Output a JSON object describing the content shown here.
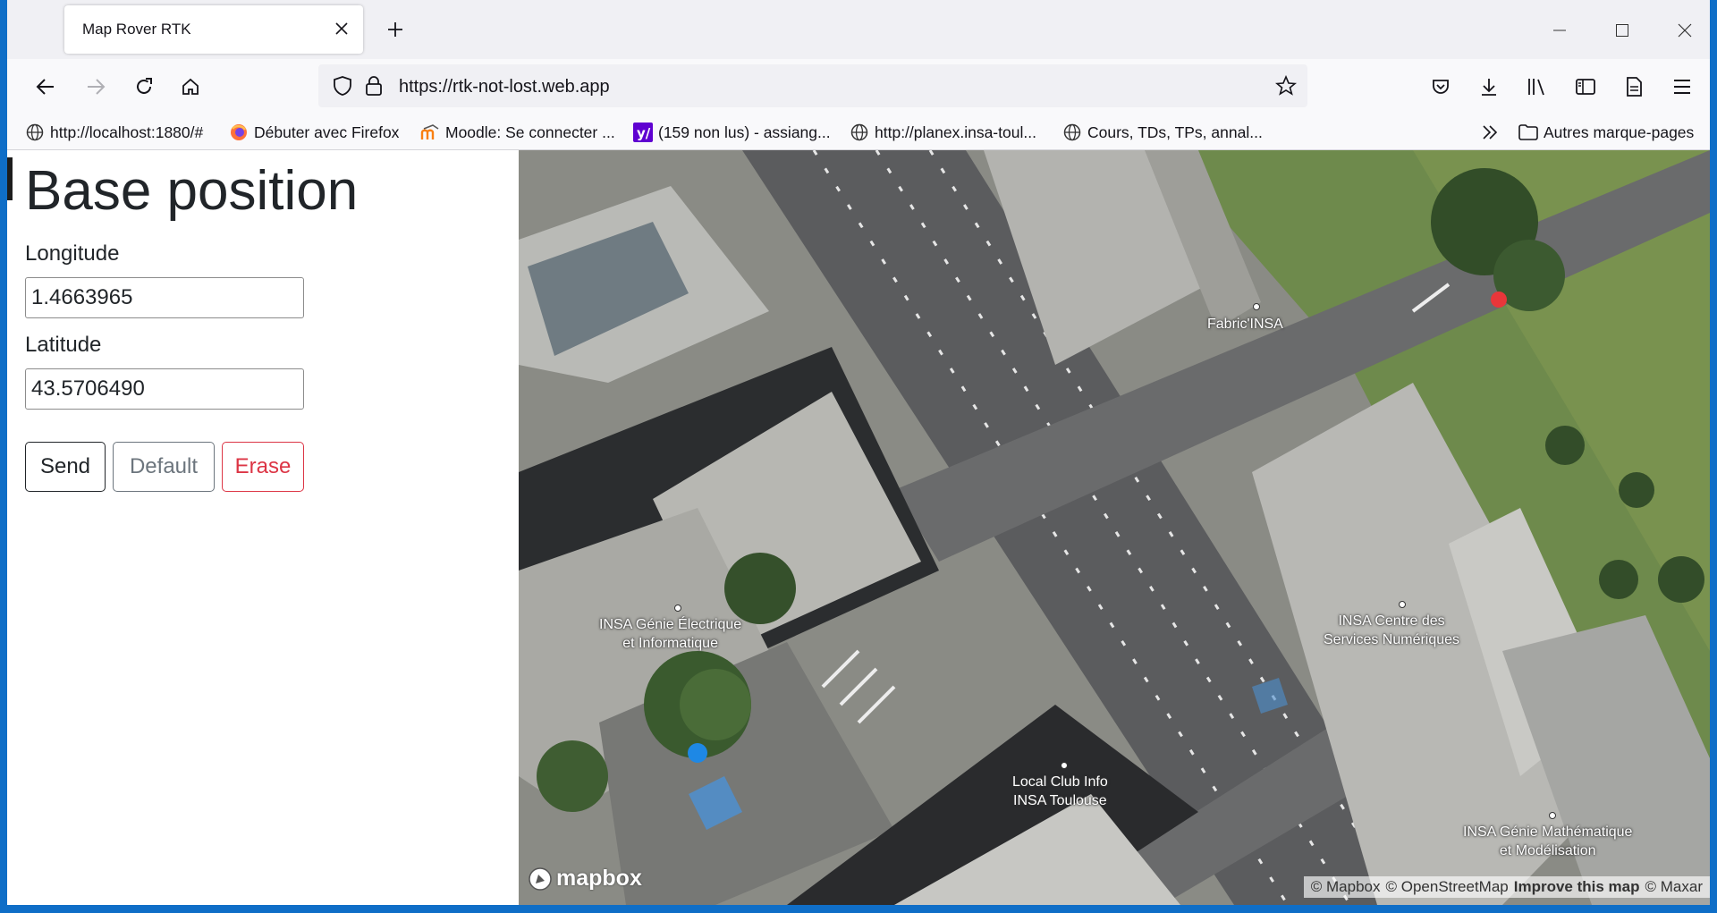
{
  "browser": {
    "tab_title": "Map Rover RTK",
    "url": "https://rtk-not-lost.web.app"
  },
  "bookmarks": [
    {
      "label": "http://localhost:1880/#",
      "icon": "globe-icon"
    },
    {
      "label": "Débuter avec Firefox",
      "icon": "firefox-icon"
    },
    {
      "label": "Moodle: Se connecter ...",
      "icon": "moodle-icon"
    },
    {
      "label": "(159 non lus) - assiang...",
      "icon": "yahoo-icon"
    },
    {
      "label": "http://planex.insa-toul...",
      "icon": "globe-icon"
    },
    {
      "label": "Cours, TDs, TPs, annal...",
      "icon": "globe-icon"
    }
  ],
  "other_bookmarks": "Autres marque-pages",
  "page": {
    "title": "Base position",
    "longitude_label": "Longitude",
    "longitude_value": "1.4663965",
    "latitude_label": "Latitude",
    "latitude_value": "43.5706490",
    "send_label": "Send",
    "default_label": "Default",
    "erase_label": "Erase"
  },
  "map": {
    "labels": {
      "fabric": "Fabric'INSA",
      "genie_elec_1": "INSA Génie Électrique",
      "genie_elec_2": "et Informatique",
      "centre_1": "INSA Centre des",
      "centre_2": "Services Numériques",
      "club_1": "Local Club Info",
      "club_2": "INSA Toulouse",
      "math_1": "INSA Génie Mathématique",
      "math_2": "et Modélisation"
    },
    "logo": "mapbox",
    "attribution": {
      "mapbox": "© Mapbox",
      "osm": "© OpenStreetMap",
      "improve": "Improve this map",
      "maxar": "© Maxar"
    },
    "colors": {
      "base_marker": "#e8363a",
      "rover_marker": "#1e88e5"
    }
  }
}
